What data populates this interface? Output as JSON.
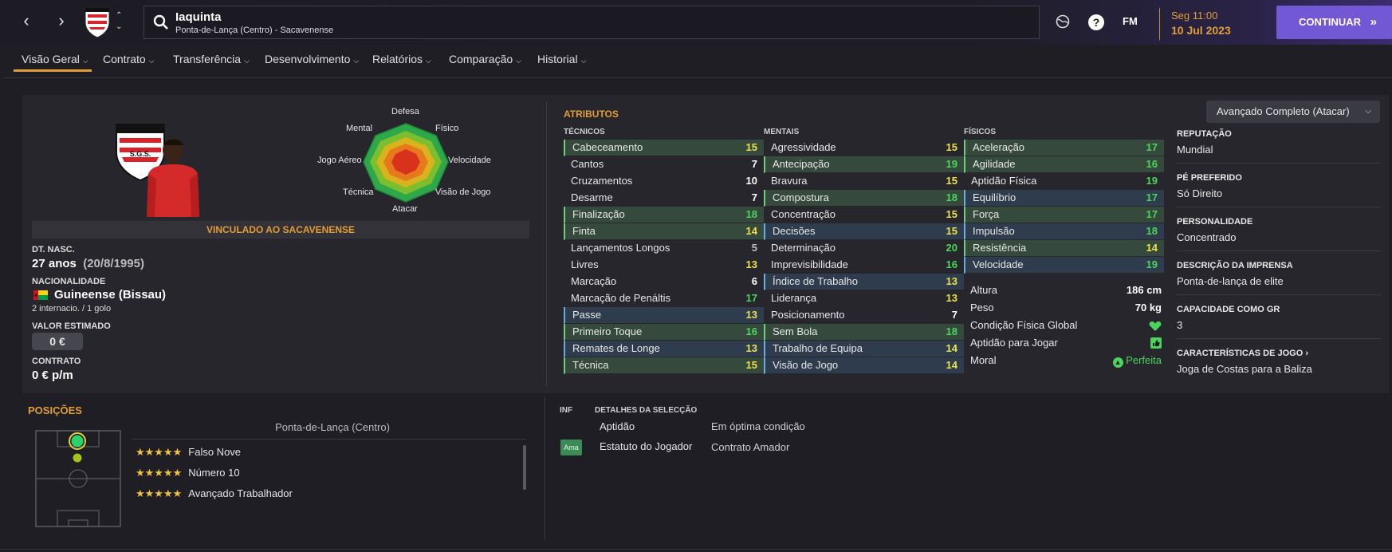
{
  "topbar": {
    "player_name": "Iaquinta",
    "subtitle": "Ponta-de-Lança (Centro) - Sacavenense",
    "fm_label": "FM",
    "date_time": "Seg 11:00",
    "date": "10 Jul 2023",
    "continue_label": "CONTINUAR",
    "continue_icon": "double-chevron-right-icon"
  },
  "tabs": [
    {
      "label": "Visão Geral"
    },
    {
      "label": "Contrato"
    },
    {
      "label": "Transferência"
    },
    {
      "label": "Desenvolvimento"
    },
    {
      "label": "Relatórios"
    },
    {
      "label": "Comparação"
    },
    {
      "label": "Historial"
    }
  ],
  "profile": {
    "radar_labels": {
      "top": "Defesa",
      "top_right": "Físico",
      "right": "Velocidade",
      "bottom_right": "Visão de Jogo",
      "bottom": "Atacar",
      "bottom_left": "Técnica",
      "left": "Jogo Aéreo",
      "top_left": "Mental"
    },
    "club_banner": "VINCULADO AO SACAVENENSE",
    "dob_label": "DT. NASC.",
    "age": "27 anos",
    "dob": "(20/8/1995)",
    "nationality_label": "NACIONALIDADE",
    "nationality": "Guineense (Bissau)",
    "caps": "2 internacio. / 1 golo",
    "value_label": "VALOR ESTIMADO",
    "value": "0 €",
    "contract_label": "CONTRATO",
    "contract": "0 € p/m"
  },
  "attributes": {
    "title": "ATRIBUTOS",
    "role_select": "Avançado Completo (Atacar)",
    "technical_header": "TÉCNICOS",
    "mental_header": "MENTAIS",
    "physical_header": "FÍSICOS",
    "technical": [
      {
        "name": "Cabeceamento",
        "value": "15",
        "hl": "g"
      },
      {
        "name": "Cantos",
        "value": "7",
        "hl": ""
      },
      {
        "name": "Cruzamentos",
        "value": "10",
        "hl": ""
      },
      {
        "name": "Desarme",
        "value": "7",
        "hl": ""
      },
      {
        "name": "Finalização",
        "value": "18",
        "hl": "g"
      },
      {
        "name": "Finta",
        "value": "14",
        "hl": "g"
      },
      {
        "name": "Lançamentos Longos",
        "value": "5",
        "hl": ""
      },
      {
        "name": "Livres",
        "value": "13",
        "hl": ""
      },
      {
        "name": "Marcação",
        "value": "6",
        "hl": ""
      },
      {
        "name": "Marcação de Penáltis",
        "value": "17",
        "hl": ""
      },
      {
        "name": "Passe",
        "value": "13",
        "hl": "b"
      },
      {
        "name": "Primeiro Toque",
        "value": "16",
        "hl": "g"
      },
      {
        "name": "Remates de Longe",
        "value": "13",
        "hl": "b"
      },
      {
        "name": "Técnica",
        "value": "15",
        "hl": "g"
      }
    ],
    "mental": [
      {
        "name": "Agressividade",
        "value": "15",
        "hl": ""
      },
      {
        "name": "Antecipação",
        "value": "19",
        "hl": "g"
      },
      {
        "name": "Bravura",
        "value": "15",
        "hl": ""
      },
      {
        "name": "Compostura",
        "value": "18",
        "hl": "g"
      },
      {
        "name": "Concentração",
        "value": "15",
        "hl": ""
      },
      {
        "name": "Decisões",
        "value": "15",
        "hl": "b"
      },
      {
        "name": "Determinação",
        "value": "20",
        "hl": ""
      },
      {
        "name": "Imprevisibilidade",
        "value": "16",
        "hl": ""
      },
      {
        "name": "Índice de Trabalho",
        "value": "13",
        "hl": "b"
      },
      {
        "name": "Liderança",
        "value": "13",
        "hl": ""
      },
      {
        "name": "Posicionamento",
        "value": "7",
        "hl": ""
      },
      {
        "name": "Sem Bola",
        "value": "18",
        "hl": "g"
      },
      {
        "name": "Trabalho de Equipa",
        "value": "14",
        "hl": "b"
      },
      {
        "name": "Visão de Jogo",
        "value": "14",
        "hl": "b"
      }
    ],
    "physical": [
      {
        "name": "Aceleração",
        "value": "17",
        "hl": "g"
      },
      {
        "name": "Agilidade",
        "value": "16",
        "hl": "g"
      },
      {
        "name": "Aptidão Física",
        "value": "19",
        "hl": ""
      },
      {
        "name": "Equilíbrio",
        "value": "17",
        "hl": "b"
      },
      {
        "name": "Força",
        "value": "17",
        "hl": "g"
      },
      {
        "name": "Impulsão",
        "value": "18",
        "hl": "b"
      },
      {
        "name": "Resistência",
        "value": "14",
        "hl": "g"
      },
      {
        "name": "Velocidade",
        "value": "19",
        "hl": "b"
      }
    ],
    "height_label": "Altura",
    "height": "186 cm",
    "weight_label": "Peso",
    "weight": "70 kg",
    "condition_label": "Condição Física Global",
    "match_fit_label": "Aptidão para Jogar",
    "morale_label": "Moral",
    "morale": "Perfeita"
  },
  "info": {
    "reputation_label": "REPUTAÇÃO",
    "reputation": "Mundial",
    "foot_label": "PÉ PREFERIDO",
    "foot": "Só Direito",
    "personality_label": "PERSONALIDADE",
    "personality": "Concentrado",
    "press_label": "DESCRIÇÃO DA IMPRENSA",
    "press": "Ponta-de-lança de elite",
    "gk_label": "CAPACIDADE COMO GR",
    "gk": "3",
    "traits_label": "CARACTERÍSTICAS DE JOGO",
    "traits": "Joga de Costas para a Baliza"
  },
  "positions": {
    "title": "POSIÇÕES",
    "main_position": "Ponta-de-Lança (Centro)",
    "roles": [
      {
        "stars": "★★★★★",
        "name": "Falso Nove"
      },
      {
        "stars": "★★★★★",
        "name": "Número 10"
      },
      {
        "stars": "★★★★★",
        "name": "Avançado Trabalhador"
      }
    ]
  },
  "selection": {
    "inf_header": "INF",
    "details_header": "DETALHES DA SELECÇÃO",
    "fitness_label": "Aptidão",
    "fitness": "Em óptima condição",
    "status_badge": "Ama",
    "status_label": "Estatuto do Jogador",
    "status": "Contrato Amador"
  },
  "colors": {
    "accent": "#e39d36",
    "button": "#7358d6",
    "good": "#4ad65a",
    "high": "#ece34a"
  }
}
